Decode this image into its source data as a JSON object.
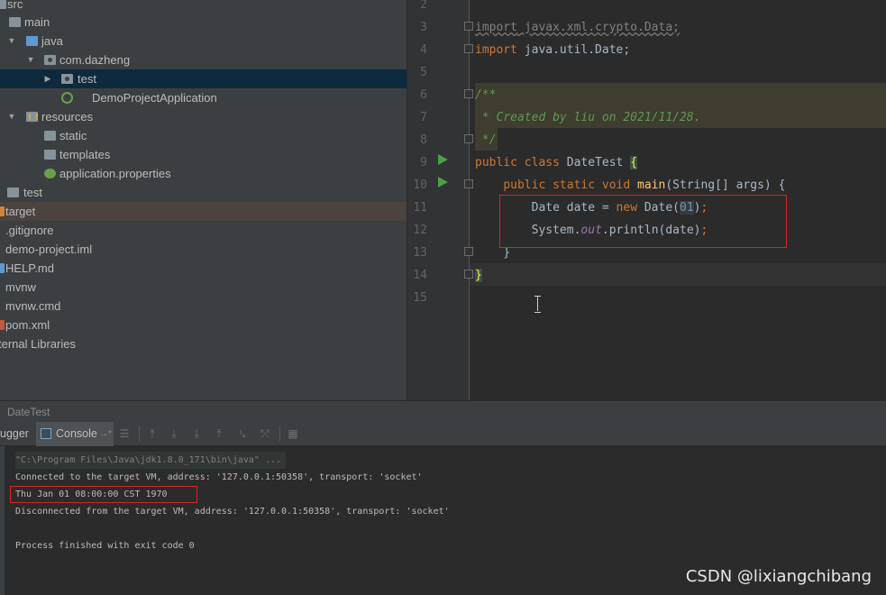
{
  "project_tree": {
    "items": [
      {
        "label": "src",
        "icon": "folder-icon"
      },
      {
        "label": "main",
        "icon": "folder-icon"
      },
      {
        "label": "java",
        "icon": "source-folder-icon"
      },
      {
        "label": "com.dazheng",
        "icon": "package-icon"
      },
      {
        "label": "test",
        "icon": "package-icon"
      },
      {
        "label": "DemoProjectApplication",
        "icon": "spring-boot-app-icon"
      },
      {
        "label": "resources",
        "icon": "resources-folder-icon"
      },
      {
        "label": "static",
        "icon": "folder-icon"
      },
      {
        "label": "templates",
        "icon": "folder-icon"
      },
      {
        "label": "application.properties",
        "icon": "spring-properties-icon"
      },
      {
        "label": "test",
        "icon": "folder-icon"
      },
      {
        "label": "target",
        "icon": "folder-excluded-icon"
      },
      {
        "label": ".gitignore",
        "icon": "file-icon"
      },
      {
        "label": "demo-project.iml",
        "icon": "file-icon"
      },
      {
        "label": "HELP.md",
        "icon": "markdown-file-icon"
      },
      {
        "label": "mvnw",
        "icon": "file-icon"
      },
      {
        "label": "mvnw.cmd",
        "icon": "file-icon"
      },
      {
        "label": "pom.xml",
        "icon": "maven-file-icon"
      },
      {
        "label": "ternal Libraries",
        "icon": "libraries-icon"
      }
    ]
  },
  "editor": {
    "line_numbers": [
      "2",
      "3",
      "4",
      "5",
      "6",
      "7",
      "8",
      "9",
      "10",
      "11",
      "12",
      "13",
      "14",
      "15"
    ],
    "code": {
      "l3_kw": "import",
      "l3_rest": " javax.xml.crypto.Data;",
      "l4_kw": "import",
      "l4_rest": " java.util.Date;",
      "l6": "/**",
      "l7": " * Created by liu on 2021/11/28.",
      "l8": " */",
      "l9_kw": "public class",
      "l9_name": " DateTest ",
      "l9_brace": "{",
      "l10_indent": "    ",
      "l10_kw": "public static void",
      "l10_sp": " ",
      "l10_meth": "main",
      "l10_rest": "(String[] args) {",
      "l11_indent": "        ",
      "l11_a": "Date date = ",
      "l11_kw": "new",
      "l11_b": " Date(",
      "l11_num": "01",
      "l11_c": ")",
      "l11_semi": ";",
      "l12_indent": "        ",
      "l12_a": "System.",
      "l12_fld": "out",
      "l12_b": ".println(date)",
      "l12_semi": ";",
      "l13": "    }",
      "l14_brace": "}"
    }
  },
  "run_panel": {
    "title": "DateTest",
    "tabs": {
      "debugger": "ugger",
      "console": "Console"
    },
    "icons": [
      "console-tab-icon",
      "pin-arrow-icon",
      "layout-icon",
      "step-over-icon",
      "step-into-icon",
      "force-step-into-icon",
      "step-out-icon",
      "drop-frame-icon",
      "run-to-cursor-icon",
      "evaluate-icon"
    ]
  },
  "console": {
    "lines": [
      "\"C:\\Program Files\\Java\\jdk1.8.0_171\\bin\\java\" ...",
      "Connected to the target VM, address: '127.0.0.1:50358', transport: 'socket'",
      "Thu Jan 01 08:00:00 CST 1970",
      "Disconnected from the target VM, address: '127.0.0.1:50358', transport: 'socket'",
      "",
      "Process finished with exit code 0"
    ]
  },
  "watermark": "CSDN @lixiangchibang",
  "colors": {
    "keyword": "#cc7832",
    "doc_comment": "#629755",
    "number": "#6897bb",
    "highlight_box": "#e02020",
    "selection": "#0d293e"
  }
}
